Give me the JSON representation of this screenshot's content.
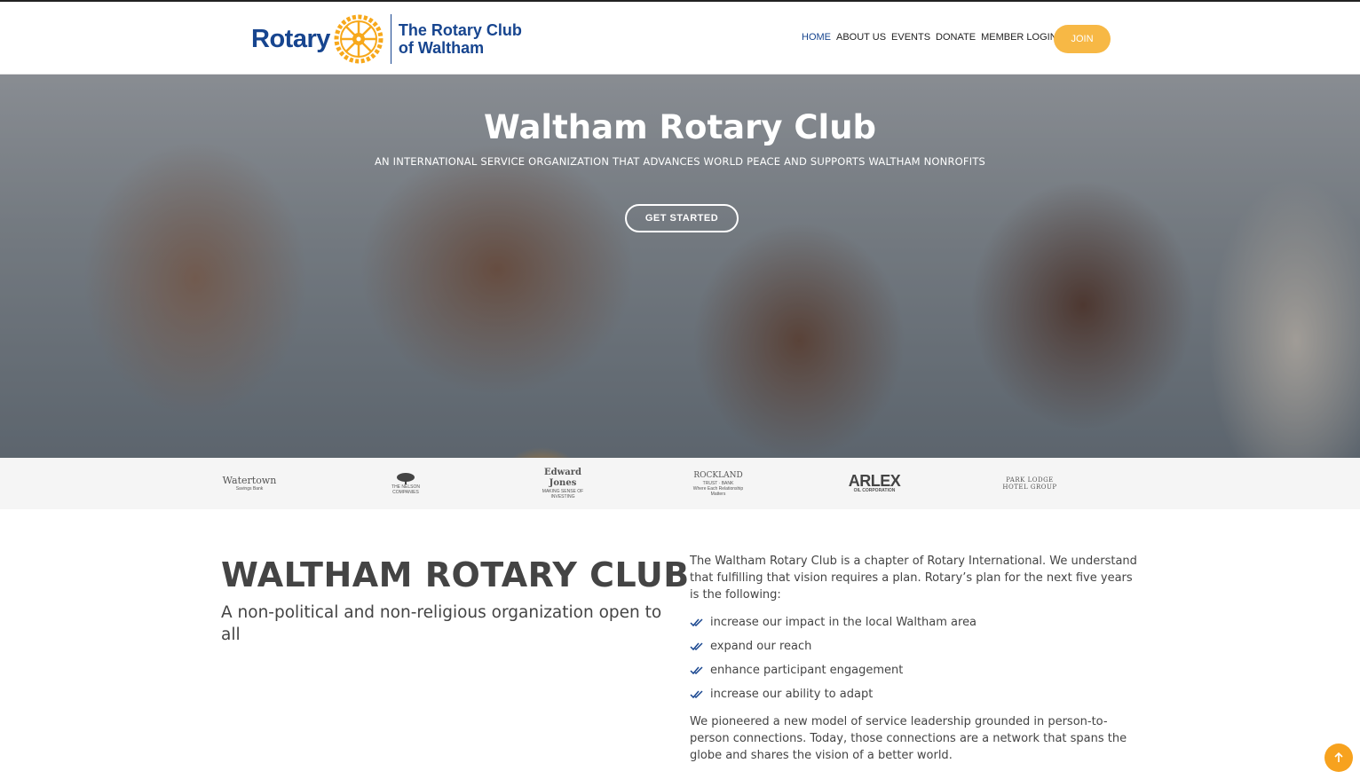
{
  "header": {
    "logo_word": "Rotary",
    "logo_club_line1": "The Rotary Club",
    "logo_club_line2": "of Waltham",
    "nav": [
      "HOME",
      "ABOUT US",
      "EVENTS",
      "DONATE",
      "MEMBER LOGIN"
    ],
    "active_nav": "HOME",
    "join_label": "JOIN"
  },
  "hero": {
    "title": "Waltham Rotary Club",
    "subtitle": "AN INTERNATIONAL SERVICE ORGANIZATION THAT ADVANCES WORLD PEACE AND SUPPORTS WALTHAM NONROFITS",
    "cta_label": "GET STARTED"
  },
  "sponsors": {
    "watertown": {
      "main": "Watertown",
      "small": "Savings Bank"
    },
    "nelson": {
      "small": "THE NELSON COMPANIES"
    },
    "edwardjones": {
      "main": "Edward Jones",
      "small": "MAKING SENSE OF INVESTING"
    },
    "rockland": {
      "main": "ROCKLAND",
      "small": "TRUST · BANK",
      "tagline": "Where Each Relationship Matters"
    },
    "arlex": {
      "main": "ARLEX",
      "small": "OIL CORPORATION"
    },
    "parklodge": {
      "line1": "PARK LODGE",
      "line2": "HOTEL GROUP"
    }
  },
  "about": {
    "title": "WALTHAM ROTARY CLUB",
    "subtitle": "A non-political and non-religious organization open to all",
    "intro": "The Waltham Rotary Club is a chapter of Rotary International. We understand that fulfilling that vision requires a plan. Rotary’s plan for the next five years is the following:",
    "goals": [
      "increase our impact in the local Waltham area",
      "expand our reach",
      "enhance participant engagement",
      "increase our ability to adapt"
    ],
    "closing": "We pioneered a new model of service leadership grounded in person-to-person connections. Today, those connections are a network that spans the globe and shares the vision of a better world."
  },
  "colors": {
    "brand_blue": "#17458f",
    "brand_gold": "#f7b845",
    "text": "#444444"
  },
  "icons": {
    "logo": "rotary-wheel-icon",
    "list_bullet": "double-check-icon",
    "back_to_top": "arrow-up-icon"
  }
}
